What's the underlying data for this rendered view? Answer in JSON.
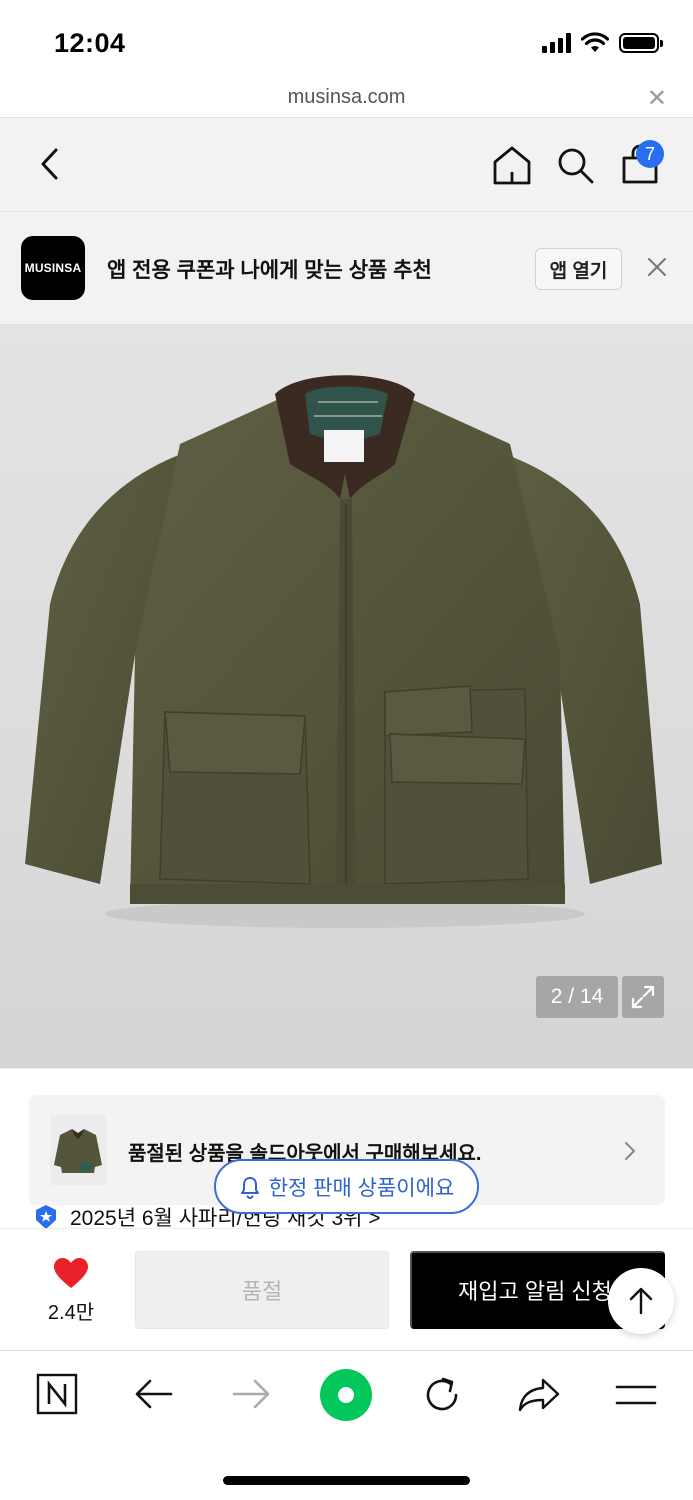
{
  "status_bar": {
    "time": "12:04"
  },
  "url_bar": {
    "url": "musinsa.com"
  },
  "header": {
    "cart_count": "7"
  },
  "app_banner": {
    "logo_text": "MUSINSA",
    "message": "앱 전용 쿠폰과 나에게 맞는 상품 추천",
    "open_label": "앱 열기"
  },
  "gallery": {
    "counter": "2 / 14"
  },
  "soldout_notice": {
    "text": "품절된 상품을 솔드아웃에서 구매해보세요."
  },
  "limited_badge": {
    "text": "한정 판매 상품이에요"
  },
  "ranking": {
    "text": "2025년 6월 사파리/헌팅 재킷 3위 >"
  },
  "action_bar": {
    "like_count": "2.4만",
    "soldout_label": "품절",
    "restock_label": "재입고 알림 신청"
  },
  "colors": {
    "accent_blue": "#2a6ef0",
    "like_red": "#e8212b",
    "toolbar_green": "#03c75a"
  }
}
